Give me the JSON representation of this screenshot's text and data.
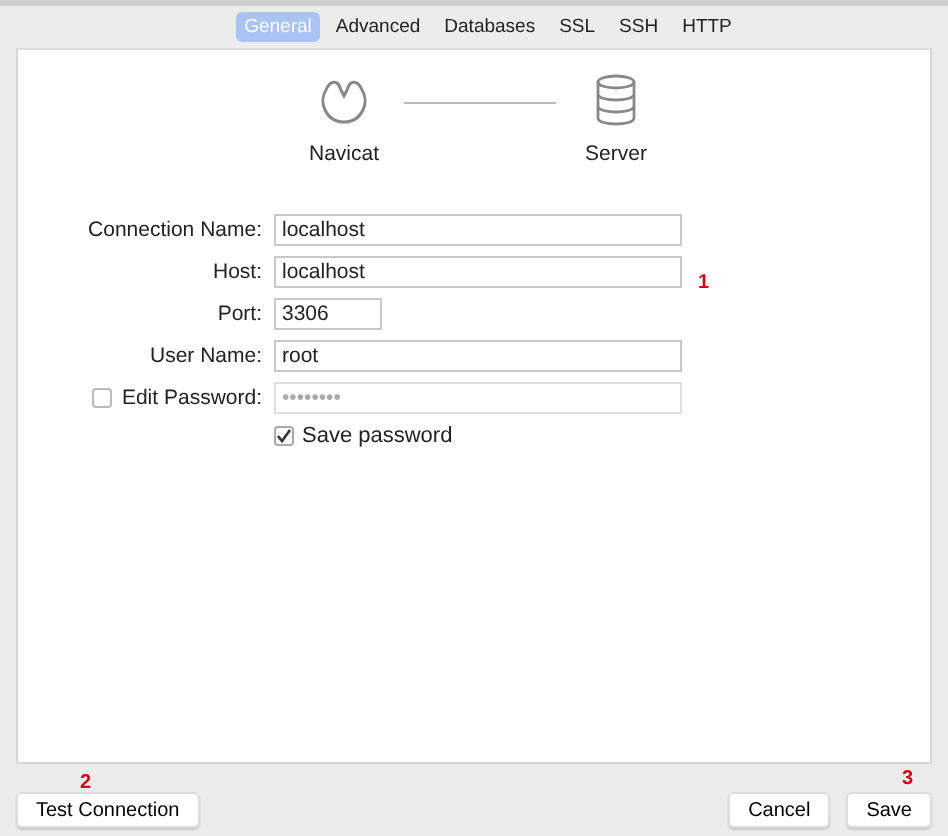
{
  "tabs": [
    {
      "label": "General",
      "selected": true
    },
    {
      "label": "Advanced",
      "selected": false
    },
    {
      "label": "Databases",
      "selected": false
    },
    {
      "label": "SSL",
      "selected": false
    },
    {
      "label": "SSH",
      "selected": false
    },
    {
      "label": "HTTP",
      "selected": false
    }
  ],
  "diagram": {
    "client": "Navicat",
    "server": "Server"
  },
  "fields": [
    {
      "kind": "text",
      "label": "Connection Name:",
      "value": "localhost"
    },
    {
      "kind": "text",
      "label": "Host:",
      "value": "localhost"
    },
    {
      "kind": "short",
      "label": "Port:",
      "value": "3306"
    },
    {
      "kind": "text",
      "label": "User Name:",
      "value": "root"
    },
    {
      "kind": "toggle",
      "label": "Edit Password:",
      "checked": false,
      "value": "••••••••",
      "disabled": true
    }
  ],
  "save_password": {
    "label": "Save password",
    "checked": true
  },
  "buttons": {
    "left": "Test Connection",
    "right": [
      "Cancel",
      "Save"
    ]
  },
  "annotations": [
    "1",
    "2",
    "3"
  ]
}
